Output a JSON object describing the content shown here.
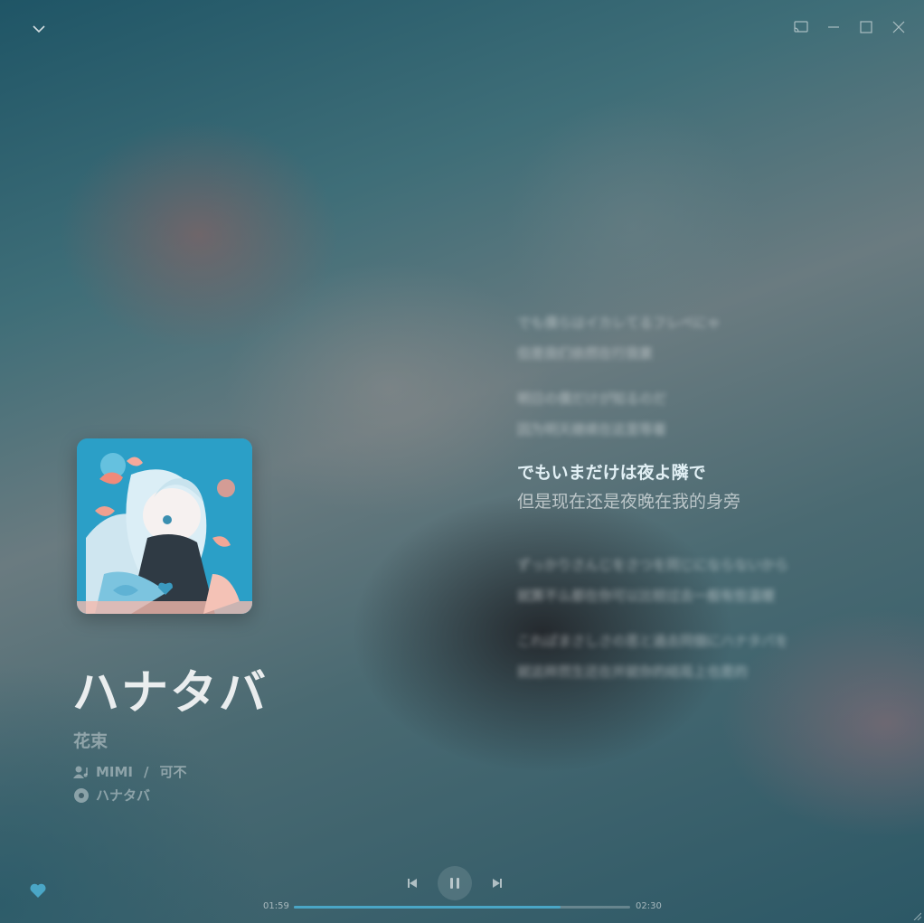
{
  "window": {
    "collapse_icon": "chevron-down-icon",
    "controls": [
      "cast-icon",
      "minimize-icon",
      "maximize-icon",
      "close-icon"
    ]
  },
  "song": {
    "title": "ハナタバ",
    "subtitle": "花束",
    "artists": [
      "MIMI",
      "可不"
    ],
    "artist_separator": "/",
    "album": "ハナタバ"
  },
  "lyrics": [
    {
      "orig": "でも僕らはイカレてるフレベにゃ",
      "trans": "但是我们依然在行我素",
      "active": false
    },
    {
      "orig": "明日の僕だけが知るのだ",
      "trans": "因为明天继续在这里等着",
      "active": false
    },
    {
      "orig": "でもいまだけは夜よ隣で",
      "trans": "但是现在还是夜晚在我的身旁",
      "active": true
    },
    {
      "orig": "ずっかりさんじをさつを同じにならないから",
      "trans": "就算不么都在你可以比较过去一般有些温暖",
      "active": false
    },
    {
      "orig": "こればまさしさの思と過去同個にハナタバを",
      "trans": "就这样然生还在并就你的结局上也是的",
      "active": false
    }
  ],
  "player": {
    "current_time": "01:59",
    "total_time": "02:30",
    "progress": 0.793,
    "liked": true,
    "accent_color": "#4aa6c6"
  }
}
